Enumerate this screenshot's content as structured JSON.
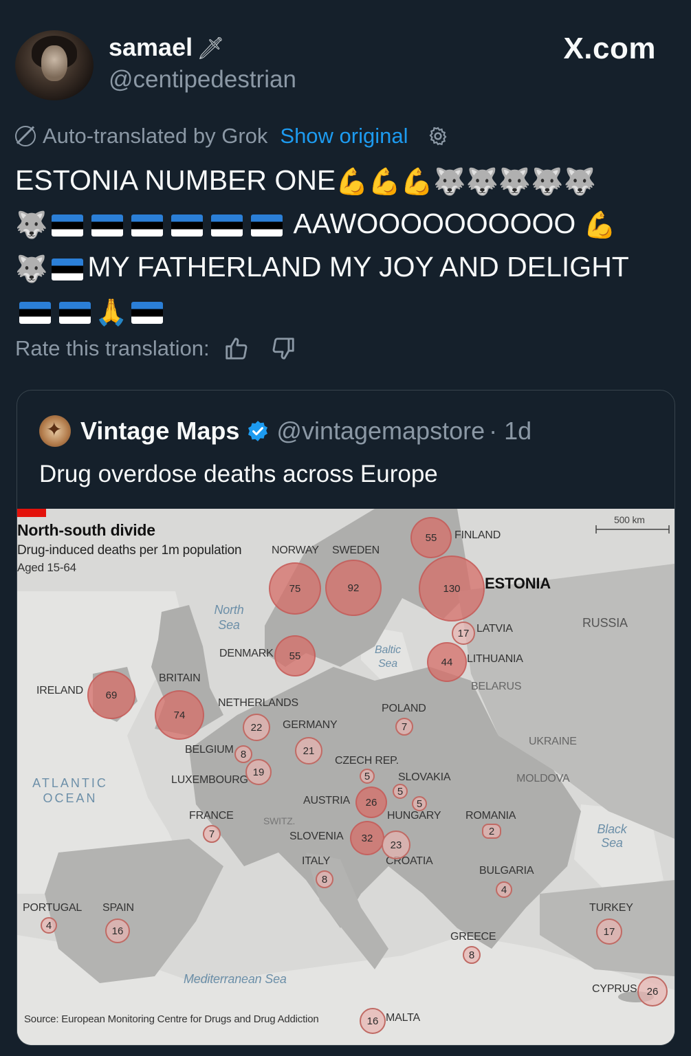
{
  "header": {
    "name": "samael",
    "handle": "@centipedestrian",
    "site": "X.com"
  },
  "translation": {
    "notice": "Auto-translated by Grok",
    "show_original": "Show original",
    "rate_label": "Rate this translation:"
  },
  "tweet": {
    "line1": "ESTONIA NUMBER ONE",
    "line2": "AAWOOOOOOOOOO",
    "line3": "MY FATHERLAND MY JOY AND DELIGHT"
  },
  "quote": {
    "name": "Vintage Maps",
    "handle": "@vintagemapstore",
    "time": "· 1d",
    "text": "Drug overdose deaths across Europe"
  },
  "map": {
    "title": "North-south divide",
    "subtitle": "Drug-induced deaths per 1m population",
    "subtitle2": "Aged 15-64",
    "scale": "500 km",
    "source": "Source: European Monitoring Centre for Drugs and Drug Addiction",
    "seas": {
      "north_sea": "North Sea",
      "baltic_sea": "Baltic Sea",
      "atlantic": "ATLANTIC OCEAN",
      "black_sea": "Black Sea",
      "mediterranean": "Mediterranean Sea"
    },
    "labels": {
      "finland": "FINLAND",
      "estonia": "ESTONIA",
      "norway": "NORWAY",
      "sweden": "SWEDEN",
      "russia": "RUSSIA",
      "latvia": "LATVIA",
      "lithuania": "LITHUANIA",
      "belarus": "BELARUS",
      "denmark": "DENMARK",
      "britain": "BRITAIN",
      "ireland": "IRELAND",
      "netherlands": "NETHERLANDS",
      "poland": "POLAND",
      "germany": "GERMANY",
      "ukraine": "UKRAINE",
      "belgium": "BELGIUM",
      "czech": "CZECH REP.",
      "luxembourg": "LUXEMBOURG",
      "slovakia": "SLOVAKIA",
      "moldova": "MOLDOVA",
      "austria": "AUSTRIA",
      "hungary": "HUNGARY",
      "france": "FRANCE",
      "switz": "SWITZ.",
      "romania": "ROMANIA",
      "slovenia": "SLOVENIA",
      "croatia": "CROATIA",
      "italy": "ITALY",
      "bulgaria": "BULGARIA",
      "portugal": "PORTUGAL",
      "spain": "SPAIN",
      "turkey": "TURKEY",
      "greece": "GREECE",
      "cyprus": "CYPRUS",
      "malta": "MALTA"
    },
    "values": {
      "finland": "55",
      "estonia": "130",
      "norway": "75",
      "sweden": "92",
      "latvia": "17",
      "lithuania": "44",
      "denmark": "55",
      "ireland": "69",
      "britain": "74",
      "netherlands": "22",
      "poland": "7",
      "germany": "21",
      "belgium": "8",
      "luxembourg": "19",
      "czech": "5",
      "slovakia": "5",
      "austria": "26",
      "hungary": "5",
      "france": "7",
      "slovenia": "32",
      "croatia": "23",
      "romania": "2",
      "italy": "8",
      "bulgaria": "4",
      "portugal": "4",
      "spain": "16",
      "turkey": "17",
      "greece": "8",
      "cyprus": "26",
      "malta": "16"
    }
  }
}
